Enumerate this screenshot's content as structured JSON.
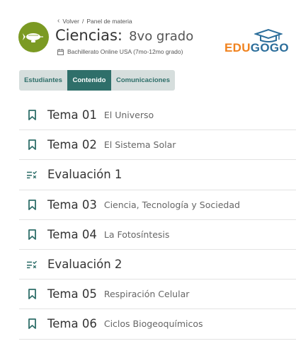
{
  "header": {
    "back_label": "Volver",
    "separator": "/",
    "breadcrumb_current": "Panel de materia",
    "subject": "Ciencias:",
    "grade": "8vo grado",
    "program": "Bachillerato Online USA (7mo-12mo grado)",
    "logo": {
      "part1": "EDU",
      "part2": "GOGO"
    }
  },
  "tabs": [
    {
      "label": "Estudiantes",
      "active": false
    },
    {
      "label": "Contenido",
      "active": true
    },
    {
      "label": "Comunicaciones",
      "active": false
    }
  ],
  "content": [
    {
      "type": "tema",
      "name": "Tema 01",
      "desc": "El Universo",
      "icon": "bookmark-icon"
    },
    {
      "type": "tema",
      "name": "Tema 02",
      "desc": "El Sistema Solar",
      "icon": "bookmark-icon"
    },
    {
      "type": "evaluacion",
      "name": "Evaluación 1",
      "desc": "",
      "icon": "checklist-icon"
    },
    {
      "type": "tema",
      "name": "Tema 03",
      "desc": "Ciencia, Tecnología y Sociedad",
      "icon": "bookmark-icon"
    },
    {
      "type": "tema",
      "name": "Tema 04",
      "desc": "La Fotosíntesis",
      "icon": "bookmark-icon"
    },
    {
      "type": "evaluacion",
      "name": "Evaluación 2",
      "desc": "",
      "icon": "checklist-icon"
    },
    {
      "type": "tema",
      "name": "Tema 05",
      "desc": "Respiración Celular",
      "icon": "bookmark-icon"
    },
    {
      "type": "tema",
      "name": "Tema 06",
      "desc": "Ciclos Biogeoquímicos",
      "icon": "bookmark-icon"
    }
  ],
  "colors": {
    "accent": "#2f6f6a",
    "tab_bg": "#d6dedd",
    "avatar": "#7b9a23",
    "logo_orange": "#f0821e",
    "logo_blue": "#2c6e9b"
  }
}
